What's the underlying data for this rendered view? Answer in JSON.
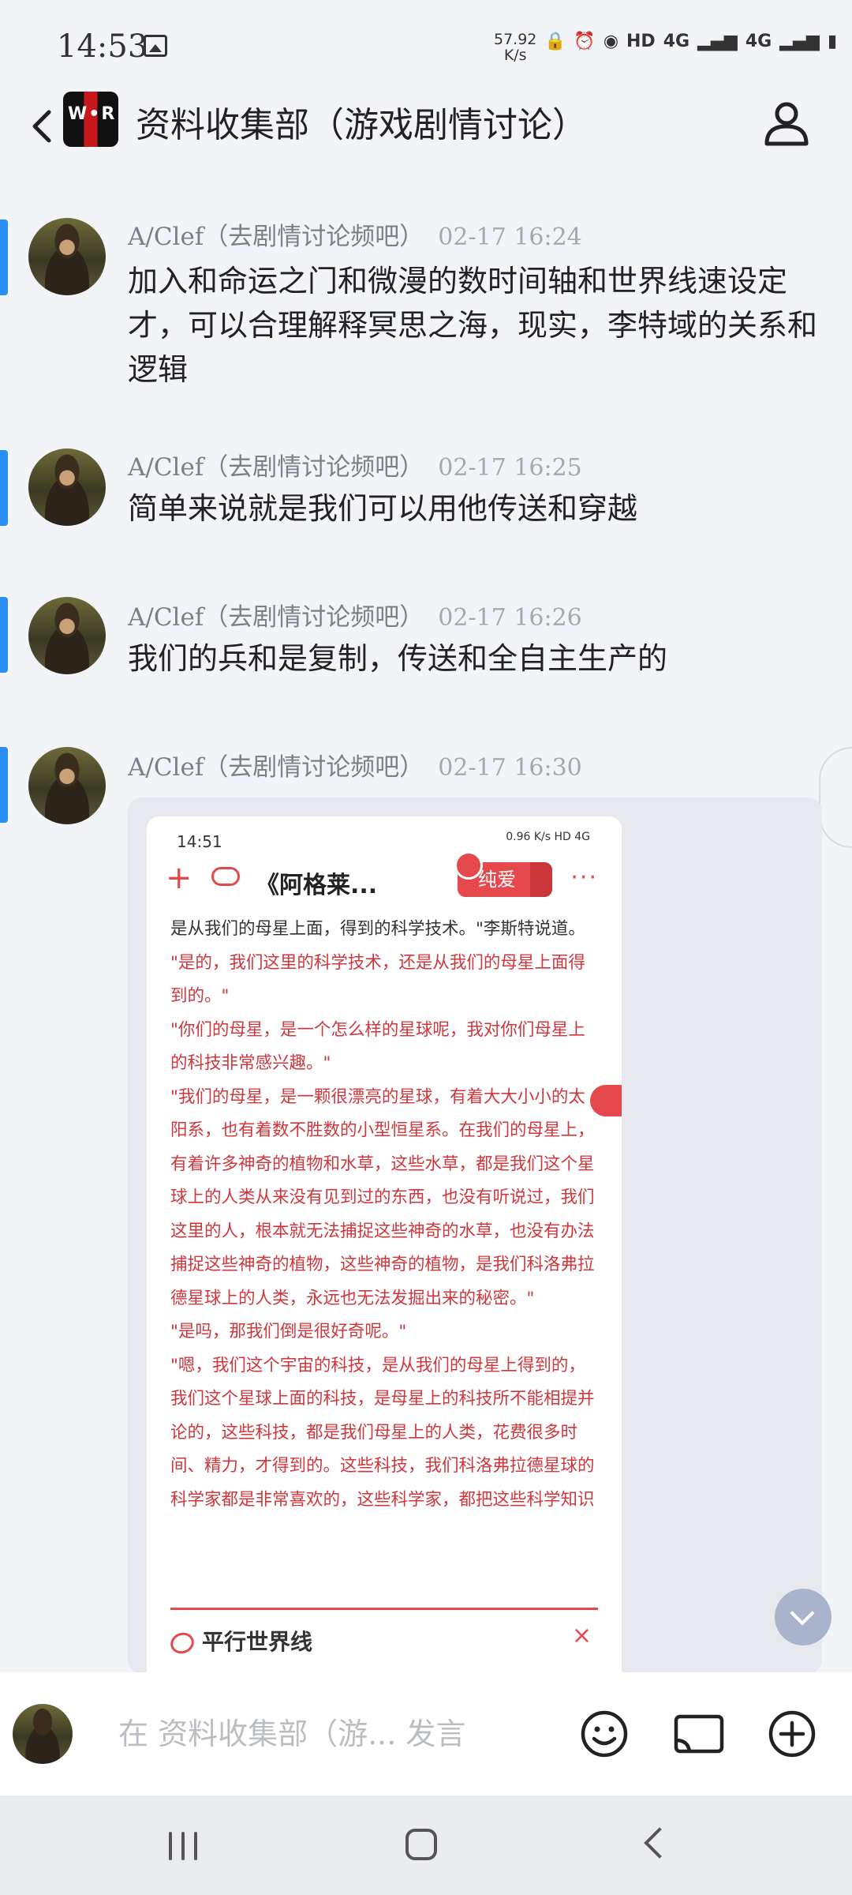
{
  "status_bar": {
    "time": "14:53",
    "speed_value": "57.92",
    "speed_unit": "K/s",
    "net_labels": [
      "HD",
      "4G",
      "4G"
    ]
  },
  "header": {
    "avatar_text": "W•R",
    "title": "资料收集部（游戏剧情讨论）"
  },
  "messages": [
    {
      "nick": "A/Clef（去剧情讨论频吧）",
      "time": "02-17 16:24",
      "text": "加入和命运之门和微漫的数时间轴和世界线速设定才，可以合理解释冥思之海，现实，李特域的关系和逻辑"
    },
    {
      "nick": "A/Clef（去剧情讨论频吧）",
      "time": "02-17 16:25",
      "text": "简单来说就是我们可以用他传送和穿越"
    },
    {
      "nick": "A/Clef（去剧情讨论频吧）",
      "time": "02-17 16:26",
      "text": "我们的兵和是复制，传送和全自主生产的"
    },
    {
      "nick": "A/Clef（去剧情讨论频吧）",
      "time": "02-17 16:30",
      "text": ""
    }
  ],
  "screenshot": {
    "time": "14:51",
    "status_icons": "0.96 K/s  HD 4G",
    "title": "《阿格莱...",
    "badge": "纯爱",
    "more": "···",
    "plus": "+",
    "first_line": "是从我们的母星上面，得到的科学技术。\"李斯特说道。",
    "paragraphs": [
      "\"是的，我们这里的科学技术，还是从我们的母星上面得到的。\"",
      "\"你们的母星，是一个怎么样的星球呢，我对你们母星上的科技非常感兴趣。\"",
      "\"我们的母星，是一颗很漂亮的星球，有着大大小小的太阳系，也有着数不胜数的小型恒星系。在我们的母星上，有着许多神奇的植物和水草，这些水草，都是我们这个星球上的人类从来没有见到过的东西，也没有听说过，我们这里的人，根本就无法捕捉这些神奇的水草，也没有办法捕捉这些神奇的植物，这些神奇的植物，是我们科洛弗拉德星球上的人类，永远也无法发掘出来的秘密。\"",
      "\"是吗，那我们倒是很好奇呢。\"",
      "\"嗯，我们这个宇宙的科技，是从我们的母星上得到的，我们这个星球上面的科技，是母星上的科技所不能相提并论的，这些科技，都是我们母星上的人类，花费很多时间、精力，才得到的。这些科技，我们科洛弗拉德星球的科学家都是非常喜欢的，这些科学家，都把这些科学知识"
    ],
    "bottom_label": "平行世界线",
    "close": "×"
  },
  "input": {
    "placeholder": "在 资料收集部（游... 发言"
  },
  "icons": {
    "back": "back-arrow-icon",
    "profile": "person-icon",
    "emoji": "smiley-icon",
    "screen": "cast-screen-icon",
    "add": "plus-circle-icon"
  },
  "colors": {
    "accent": "#2b8ef3",
    "red": "#e5484d",
    "background": "#f3f4f8"
  }
}
